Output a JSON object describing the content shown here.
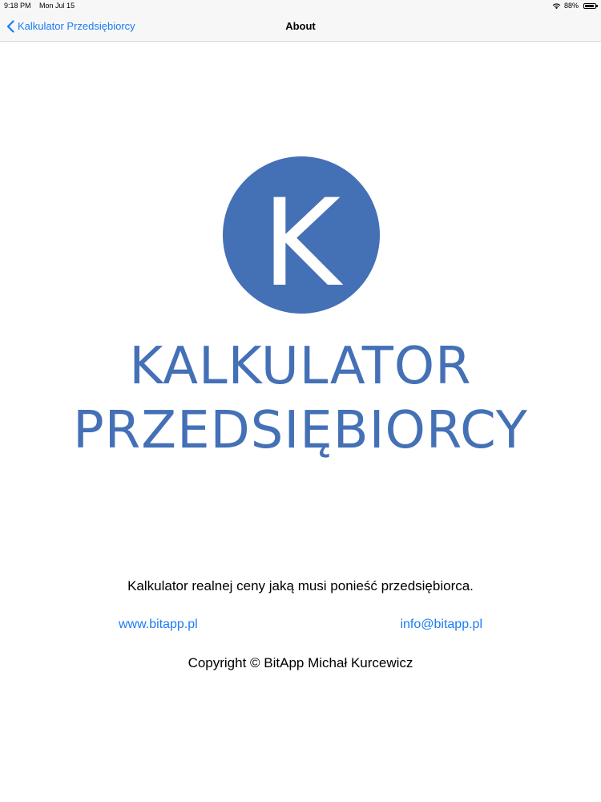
{
  "status_bar": {
    "time": "9:18 PM",
    "date": "Mon Jul 15",
    "battery_percent": "88%",
    "battery_level": 0.88,
    "icons": [
      "wifi-icon",
      "battery-icon"
    ]
  },
  "nav": {
    "back_label": "Kalkulator Przedsiębiorcy",
    "back_icon": "chevron-left-icon",
    "title": "About"
  },
  "logo": {
    "letter": "K",
    "line1": "KALKULATOR",
    "line2": "PRZEDSIĘBIORCY",
    "color": "#4470b6"
  },
  "about": {
    "description": "Kalkulator realnej ceny jaką musi ponieść przedsiębiorca.",
    "website": "www.bitapp.pl",
    "email": "info@bitapp.pl",
    "copyright": "Copyright © BitApp Michał Kurcewicz"
  },
  "colors": {
    "accent": "#1a7cf2",
    "bar_background": "#f7f7f7"
  }
}
